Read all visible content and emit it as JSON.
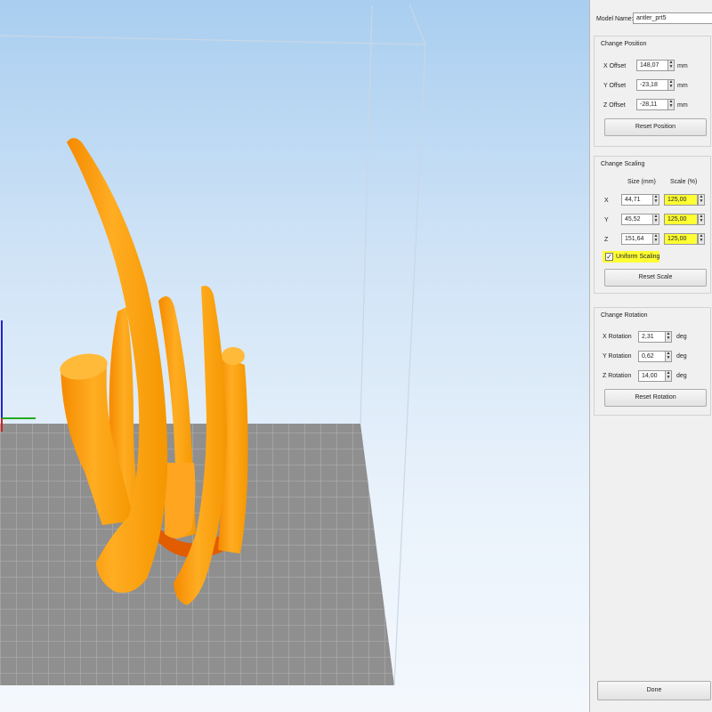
{
  "colors": {
    "model": "#ffa31a",
    "highlight": "#ffff33",
    "grid": "#8f8f8f",
    "panel": "#f0f0f0"
  },
  "panel": {
    "model_name_label": "Model Name:",
    "model_name_value": "antler_prt5",
    "position": {
      "title": "Change Position",
      "rows": [
        {
          "label": "X Offset",
          "value": "148,07",
          "unit": "mm"
        },
        {
          "label": "Y Offset",
          "value": "-23,18",
          "unit": "mm"
        },
        {
          "label": "Z Offset",
          "value": "-28,11",
          "unit": "mm"
        }
      ],
      "reset_label": "Reset Position"
    },
    "scaling": {
      "title": "Change Scaling",
      "size_header": "Size (mm)",
      "scale_header": "Scale (%)",
      "rows": [
        {
          "axis": "X",
          "size": "44,71",
          "scale": "125,00"
        },
        {
          "axis": "Y",
          "size": "45,52",
          "scale": "125,00"
        },
        {
          "axis": "Z",
          "size": "151,64",
          "scale": "125,00"
        }
      ],
      "uniform_label": "Uniform Scaling",
      "uniform_checked": true,
      "reset_label": "Reset Scale"
    },
    "rotation": {
      "title": "Change Rotation",
      "rows": [
        {
          "label": "X Rotation",
          "value": "2,31",
          "unit": "deg"
        },
        {
          "label": "Y Rotation",
          "value": "0,62",
          "unit": "deg"
        },
        {
          "label": "Z Rotation",
          "value": "14,00",
          "unit": "deg"
        }
      ],
      "reset_label": "Reset Rotation"
    },
    "done_label": "Done"
  }
}
